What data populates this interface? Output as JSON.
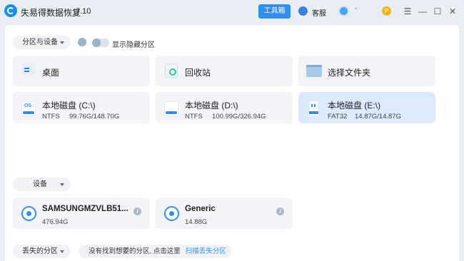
{
  "titlebar": {
    "app_name": "失易得数据恢复",
    "version": "7.10",
    "toolbox_label": "工具箱",
    "support_label": "客服",
    "user_label": "-"
  },
  "sections": {
    "partitions_label": "分区与设备",
    "show_hidden_label": "显示隐藏分区",
    "devices_label": "设备",
    "lost_label": "丢失的分区"
  },
  "quick": [
    {
      "title": "桌面",
      "icon": "desktop-icon"
    },
    {
      "title": "回收站",
      "icon": "recycle-bin-icon"
    },
    {
      "title": "选择文件夹",
      "icon": "folder-icon"
    }
  ],
  "drives": [
    {
      "title": "本地磁盘 (C:\\)",
      "fs": "NTFS",
      "size": "99.76G/148.70G",
      "icon": "system-drive-icon"
    },
    {
      "title": "本地磁盘 (D:\\)",
      "fs": "NTFS",
      "size": "100.99G/326.94G",
      "icon": "drive-icon"
    },
    {
      "title": "本地磁盘 (E:\\)",
      "fs": "FAT32",
      "size": "14.87G/14.87G",
      "icon": "usb-drive-icon"
    }
  ],
  "devices": [
    {
      "title": "SAMSUNGMZVLB51...",
      "size": "476.94G",
      "icon": "disk-icon"
    },
    {
      "title": "Generic",
      "size": "14.88G",
      "icon": "disk-icon"
    }
  ],
  "lost": {
    "tip": "没有找到想要的分区, 点击这里",
    "link": "扫描丢失分区"
  },
  "colors": {
    "accent": "#2f8ef0",
    "selected_card": "#dbeafc",
    "background": "#e9eef5"
  }
}
